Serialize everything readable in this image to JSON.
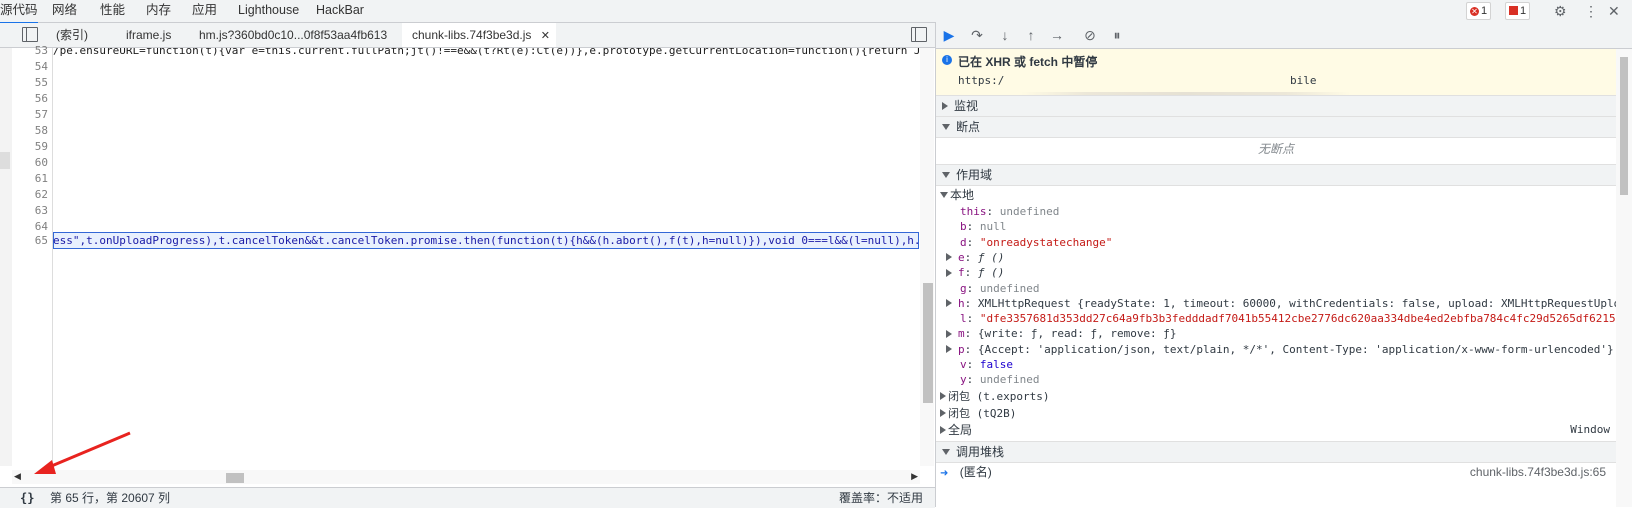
{
  "top_tabs": [
    "源代码",
    "网络",
    "性能",
    "内存",
    "应用",
    "Lighthouse",
    "HackBar"
  ],
  "errors_count": "1",
  "issues_count": "1",
  "editor_tabs": [
    "(索引)",
    "iframe.js",
    "hm.js?360bd0c10...0f8f53aa4fb613",
    "chunk-libs.74f3be3d.js"
  ],
  "line_numbers": [
    "53",
    "54",
    "55",
    "56",
    "57",
    "58",
    "59",
    "60",
    "61",
    "62",
    "63",
    "64",
    "65"
  ],
  "code_line_53": "/pe.ensureURL=function(t){var e=this.current.fullPath;jt()!==e&&(t?Rt(e):Ct(e))},e.prototype.getCurrentLocation=function(){return Jt",
  "code_line_65": "ess\",t.onUploadProgress),t.cancelToken&&t.cancelToken.promise.then(function(t){h&&(h.abort(),f(t),h=null)}),void 0===l&&(l=null),h.s",
  "status": {
    "pretty_print": "{}",
    "position": "第 65 行，第 20607 列",
    "coverage": "覆盖率：不适用"
  },
  "pause": {
    "title": "已在 XHR 或 fetch 中暂停",
    "url_start": "https:/",
    "url_end": "bile"
  },
  "sections": {
    "watch": "监视",
    "breakpoints": "断点",
    "no_breakpoints": "无断点",
    "scope": "作用域",
    "local": "本地",
    "closure1": "闭包 (t.exports)",
    "closure2": "闭包 (tQ2B)",
    "global": "全局",
    "global_value": "Window",
    "callstack": "调用堆栈",
    "frame_name": "(匿名)",
    "frame_location": "chunk-libs.74f3be3d.js:65"
  },
  "scope_vars": [
    {
      "name": "this",
      "value": "undefined",
      "kind": "undef",
      "expand": false
    },
    {
      "name": "b",
      "value": "null",
      "kind": "undef",
      "expand": false
    },
    {
      "name": "d",
      "value": "\"onreadystatechange\"",
      "kind": "str",
      "expand": false
    },
    {
      "name": "e",
      "value": "ƒ ()",
      "kind": "fn",
      "expand": true
    },
    {
      "name": "f",
      "value": "ƒ ()",
      "kind": "fn",
      "expand": true
    },
    {
      "name": "g",
      "value": "undefined",
      "kind": "undef",
      "expand": false
    },
    {
      "name": "h",
      "value": "XMLHttpRequest {readyState: 1, timeout: 60000, withCredentials: false, upload: XMLHttpRequestUplo",
      "kind": "obj",
      "expand": true
    },
    {
      "name": "l",
      "value": "\"dfe3357681d353dd27c64a9fb3b3fedddadf7041b55412cbe2776dc620aa334dbe4ed2ebfba784c4fc29d5265df6215",
      "kind": "str",
      "expand": false
    },
    {
      "name": "m",
      "value": "{write: ƒ, read: ƒ, remove: ƒ}",
      "kind": "obj",
      "expand": true
    },
    {
      "name": "p",
      "value": "{Accept: 'application/json, text/plain, */*', Content-Type: 'application/x-www-form-urlencoded'}",
      "kind": "obj",
      "expand": true
    },
    {
      "name": "v",
      "value": "false",
      "kind": "num",
      "expand": false
    },
    {
      "name": "y",
      "value": "undefined",
      "kind": "undef",
      "expand": false
    }
  ],
  "colors": {
    "accent": "#1a73e8",
    "error": "#d93025",
    "pause_bg": "#fffbe5"
  }
}
